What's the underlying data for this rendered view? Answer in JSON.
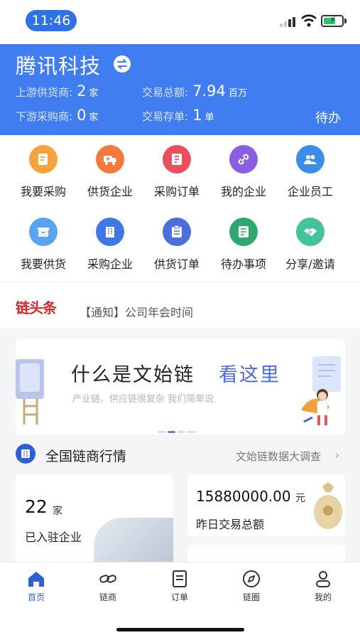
{
  "status_bar": {
    "time": "11:46"
  },
  "header": {
    "company": "腾讯科技",
    "stats": [
      {
        "label": "上游供货商:",
        "value": "2",
        "unit": "家"
      },
      {
        "label": "交易总额:",
        "value": "7.94",
        "unit": "百万"
      },
      {
        "label": "下游采购商:",
        "value": "0",
        "unit": "家"
      },
      {
        "label": "交易存单:",
        "value": "1",
        "unit": "单"
      }
    ],
    "todo": "待办"
  },
  "menu": [
    {
      "label": "我要采购",
      "icon": "purchase-icon",
      "color": "#f5a33a"
    },
    {
      "label": "供货企业",
      "icon": "truck-icon",
      "color": "#f37a3c"
    },
    {
      "label": "采购订单",
      "icon": "order-icon",
      "color": "#ea4f5e"
    },
    {
      "label": "我的企业",
      "icon": "link-icon",
      "color": "#8a5ee0"
    },
    {
      "label": "企业员工",
      "icon": "staff-icon",
      "color": "#3b8ee8"
    },
    {
      "label": "我要供货",
      "icon": "box-icon",
      "color": "#5aa3f0"
    },
    {
      "label": "采购企业",
      "icon": "building-icon",
      "color": "#3d78e6"
    },
    {
      "label": "供货订单",
      "icon": "supply-order-icon",
      "color": "#4a6fdc"
    },
    {
      "label": "待办事项",
      "icon": "todo-list-icon",
      "color": "#2fa870"
    },
    {
      "label": "分享/邀请",
      "icon": "handshake-icon",
      "color": "#43c29b"
    }
  ],
  "news": {
    "logo": "链头条",
    "text": "【通知】公司年会时间"
  },
  "banner": {
    "title": "什么是文始链",
    "title_highlight": "看这里",
    "subtitle": "产业链、供应链很复杂  我们简单说"
  },
  "section": {
    "title": "全国链商行情",
    "more": "文始链数据大调查",
    "arrow": "›"
  },
  "cards": {
    "enterprises": {
      "value": "22",
      "unit": "家",
      "label": "已入驻企业"
    },
    "volume": {
      "value": "15880000.00",
      "unit": "元",
      "label": "昨日交易总额"
    }
  },
  "tabs": [
    {
      "label": "首页",
      "icon": "home-icon",
      "active": true
    },
    {
      "label": "链商",
      "icon": "chain-icon",
      "active": false
    },
    {
      "label": "订单",
      "icon": "orders-icon",
      "active": false
    },
    {
      "label": "链圈",
      "icon": "compass-icon",
      "active": false
    },
    {
      "label": "我的",
      "icon": "profile-icon",
      "active": false
    }
  ],
  "colors": {
    "primary": "#3f7df0",
    "accent": "#2f5fd6",
    "highlight": "#4a6bdf"
  }
}
